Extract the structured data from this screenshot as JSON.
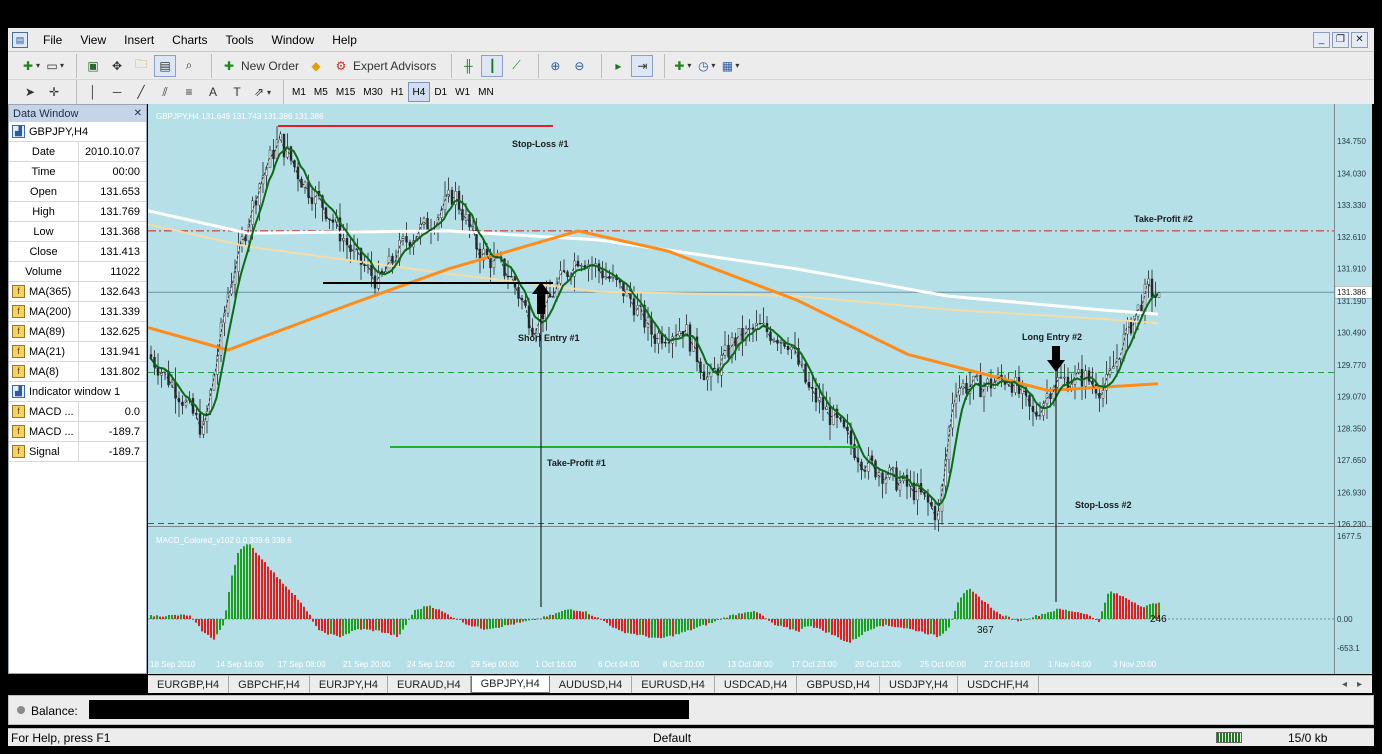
{
  "menubar": {
    "items": [
      "File",
      "View",
      "Insert",
      "Charts",
      "Tools",
      "Window",
      "Help"
    ]
  },
  "toolbar": {
    "new_order": "New Order",
    "expert_advisors": "Expert Advisors"
  },
  "timeframes": {
    "items": [
      "M1",
      "M5",
      "M15",
      "M30",
      "H1",
      "H4",
      "D1",
      "W1",
      "MN"
    ],
    "active": "H4"
  },
  "data_window": {
    "title": "Data Window",
    "symbol": "GBPJPY,H4",
    "rows": [
      {
        "label": "Date",
        "value": "2010.10.07",
        "icon": false
      },
      {
        "label": "Time",
        "value": "00:00",
        "icon": false
      },
      {
        "label": "Open",
        "value": "131.653",
        "icon": false
      },
      {
        "label": "High",
        "value": "131.769",
        "icon": false
      },
      {
        "label": "Low",
        "value": "131.368",
        "icon": false
      },
      {
        "label": "Close",
        "value": "131.413",
        "icon": false
      },
      {
        "label": "Volume",
        "value": "11022",
        "icon": false
      },
      {
        "label": "MA(365)",
        "value": "132.643",
        "icon": true
      },
      {
        "label": "MA(200)",
        "value": "131.339",
        "icon": true
      },
      {
        "label": "MA(89)",
        "value": "132.625",
        "icon": true
      },
      {
        "label": "MA(21)",
        "value": "131.941",
        "icon": true
      },
      {
        "label": "MA(8)",
        "value": "131.802",
        "icon": true
      }
    ],
    "indicator_title": "Indicator window 1",
    "indicator_rows": [
      {
        "label": "MACD ...",
        "value": "0.0"
      },
      {
        "label": "MACD ...",
        "value": "-189.7"
      },
      {
        "label": "Signal",
        "value": "-189.7"
      }
    ]
  },
  "chart": {
    "header": "GBPJPY,H4  131.649 131.743 131.386 131.386",
    "price_labels": [
      "134.750",
      "134.030",
      "133.330",
      "132.610",
      "131.910",
      "131.386",
      "131.190",
      "130.490",
      "129.770",
      "129.070",
      "128.350",
      "127.650",
      "126.930",
      "126.230"
    ],
    "current_price": "131.386",
    "annotations": {
      "stop_loss_1": "Stop-Loss #1",
      "short_entry_1": "Short Entry #1",
      "take_profit_1": "Take-Profit #1",
      "take_profit_2": "Take-Profit #2",
      "long_entry_2": "Long Entry #2",
      "stop_loss_2": "Stop-Loss #2"
    },
    "macd_header": "MACD_Colored_v102 0.0 339.6 339.6",
    "macd_labels": [
      "1677.5",
      "0.00",
      "-653.1"
    ],
    "macd_annotations": [
      "367",
      "246"
    ],
    "x_labels": [
      "18 Sep 2010",
      "14 Sep 16:00",
      "17 Sep 08:00",
      "21 Sep 20:00",
      "24 Sep 12:00",
      "29 Sep 00:00",
      "1 Oct 16:00",
      "6 Oct 04:00",
      "8 Oct 20:00",
      "13 Oct 08:00",
      "17 Oct 23:00",
      "20 Oct 12:00",
      "25 Oct 00:00",
      "27 Oct 16:00",
      "1 Nov 04:00",
      "3 Nov 20:00"
    ],
    "colors": {
      "background": "#b5e0e8",
      "ma365": "#ffffff",
      "ma200": "#f3dca8",
      "ma89": "#ff8c1a",
      "ma21": "#0b6b16",
      "up_bar": "#1aa01a",
      "down_bar": "#e02020"
    }
  },
  "tabs": {
    "items": [
      "EURGBP,H4",
      "GBPCHF,H4",
      "EURJPY,H4",
      "EURAUD,H4",
      "GBPJPY,H4",
      "AUDUSD,H4",
      "EURUSD,H4",
      "USDCAD,H4",
      "GBPUSD,H4",
      "USDJPY,H4",
      "USDCHF,H4"
    ],
    "active": "GBPJPY,H4"
  },
  "terminal": {
    "balance_label": "Balance:"
  },
  "statusbar": {
    "help": "For Help, press F1",
    "profile": "Default",
    "traffic": "15/0 kb"
  }
}
